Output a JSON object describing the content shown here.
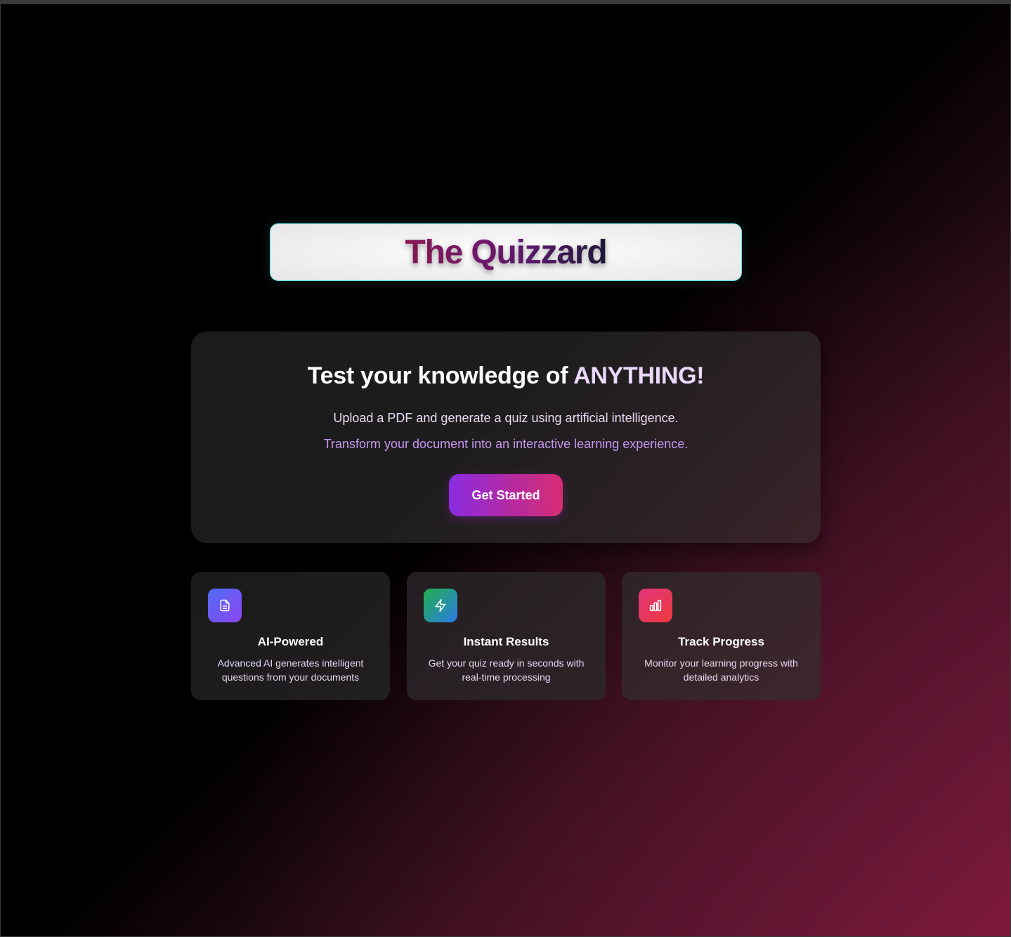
{
  "header": {
    "title": "The Quizzard"
  },
  "hero": {
    "heading_prefix": "Test your knowledge of ",
    "heading_highlight": "ANYTHING!",
    "subtitle": "Upload a PDF and generate a quiz using artificial intelligence.",
    "tagline": "Transform your document into an interactive learning experience.",
    "cta_label": "Get Started"
  },
  "features": [
    {
      "icon": "document-icon",
      "title": "AI-Powered",
      "description": "Advanced AI generates intelligent questions from your documents"
    },
    {
      "icon": "lightning-icon",
      "title": "Instant Results",
      "description": "Get your quiz ready in seconds with real-time processing"
    },
    {
      "icon": "bar-chart-icon",
      "title": "Track Progress",
      "description": "Monitor your learning progress with detailed analytics"
    }
  ],
  "colors": {
    "accent_cyan": "#5fe3ea",
    "cta_start": "#8a2be2",
    "cta_end": "#d82c72",
    "tagline": "#c796ef",
    "background_corner": "#7a1838"
  }
}
